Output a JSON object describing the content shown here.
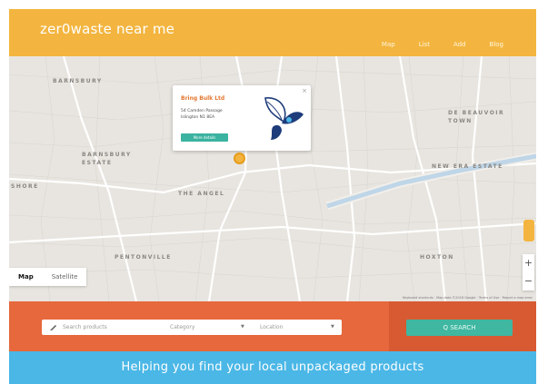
{
  "header": {
    "logo_text": "zer0waste near me",
    "nav": [
      "Map",
      "List",
      "Add",
      "Blog"
    ],
    "bg_color": "#f3b53f"
  },
  "map": {
    "areas": [
      "BARNSBURY",
      "BARNSBURY ESTATE",
      "THE ANGEL",
      "PENTONVILLE",
      "DE BEAUVOIR TOWN",
      "NEW ERA ESTATE",
      "HOXTON",
      "SHORE"
    ],
    "popup": {
      "title": "Bring Bulk Ltd",
      "address_line1": "54 Camden Passage",
      "address_line2": "Islington N1 8EA",
      "button_label": "More details",
      "close_label": "×"
    },
    "map_type": {
      "active": "Map",
      "inactive": "Satellite"
    },
    "zoom_in": "+",
    "zoom_out": "−",
    "attribution": "Keyboard shortcuts · Map data ©2018 Google · Terms of Use · Report a map error",
    "marker_icon": "map-pin-icon"
  },
  "search": {
    "search_placeholder": "Search products",
    "category_placeholder": "Category",
    "location_placeholder": "Location",
    "search_button": "Q  SEARCH",
    "band_color": "#e6683c",
    "button_color": "#3fb7a1"
  },
  "tagline": {
    "text": "Helping you find your local unpackaged products",
    "bg_color": "#4bb7e6"
  }
}
